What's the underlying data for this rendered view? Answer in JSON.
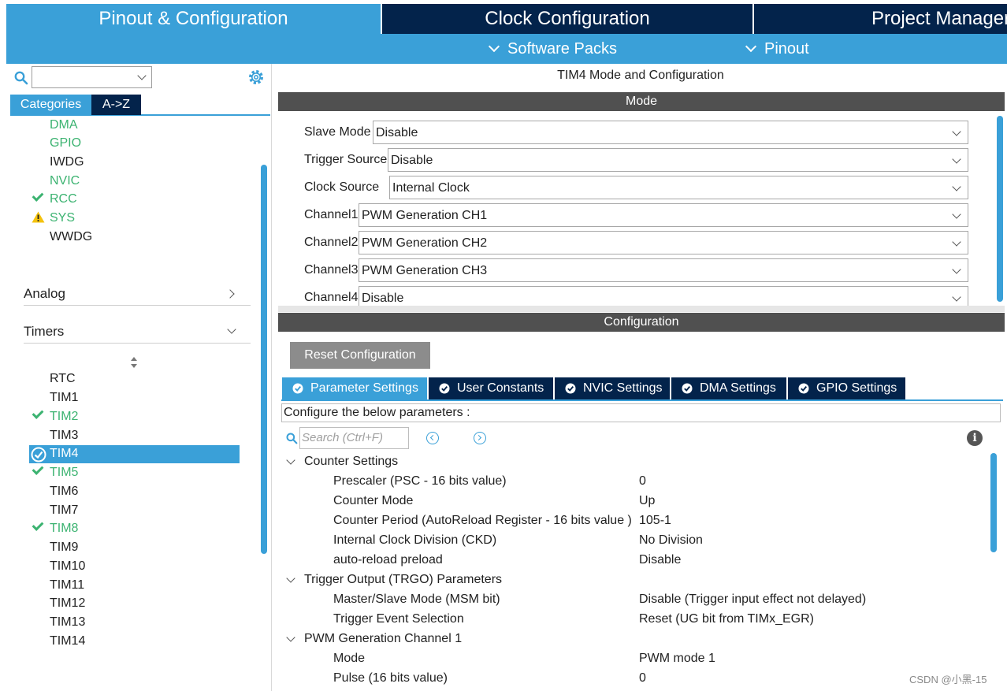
{
  "top_tabs": [
    "Pinout & Configuration",
    "Clock Configuration",
    "Project Manager"
  ],
  "sub_tabs": [
    "Software Packs",
    "Pinout"
  ],
  "left": {
    "category_tabs": [
      "Categories",
      "A->Z"
    ],
    "system_items": [
      {
        "label": "DMA",
        "state": "green"
      },
      {
        "label": "GPIO",
        "state": "green"
      },
      {
        "label": "IWDG",
        "state": "plain"
      },
      {
        "label": "NVIC",
        "state": "green"
      },
      {
        "label": "RCC",
        "state": "check"
      },
      {
        "label": "SYS",
        "state": "warning"
      },
      {
        "label": "WWDG",
        "state": "plain"
      }
    ],
    "sections": [
      "Analog",
      "Timers"
    ],
    "timer_items": [
      {
        "label": "RTC",
        "state": "plain"
      },
      {
        "label": "TIM1",
        "state": "plain"
      },
      {
        "label": "TIM2",
        "state": "check"
      },
      {
        "label": "TIM3",
        "state": "plain"
      },
      {
        "label": "TIM4",
        "state": "selected"
      },
      {
        "label": "TIM5",
        "state": "check"
      },
      {
        "label": "TIM6",
        "state": "plain"
      },
      {
        "label": "TIM7",
        "state": "plain"
      },
      {
        "label": "TIM8",
        "state": "check"
      },
      {
        "label": "TIM9",
        "state": "plain"
      },
      {
        "label": "TIM10",
        "state": "plain"
      },
      {
        "label": "TIM11",
        "state": "plain"
      },
      {
        "label": "TIM12",
        "state": "plain"
      },
      {
        "label": "TIM13",
        "state": "plain"
      },
      {
        "label": "TIM14",
        "state": "plain"
      }
    ]
  },
  "mode": {
    "title": "TIM4 Mode and Configuration",
    "header": "Mode",
    "rows": [
      {
        "label": "Slave Mode",
        "value": "Disable"
      },
      {
        "label": "Trigger Source",
        "value": "Disable"
      },
      {
        "label": "Clock Source",
        "value": "Internal Clock"
      },
      {
        "label": "Channel1",
        "value": "PWM Generation CH1"
      },
      {
        "label": "Channel2",
        "value": "PWM Generation CH2"
      },
      {
        "label": "Channel3",
        "value": "PWM Generation CH3"
      },
      {
        "label": "Channel4",
        "value": "Disable"
      }
    ]
  },
  "config": {
    "header": "Configuration",
    "reset_label": "Reset Configuration",
    "tabs": [
      "Parameter Settings",
      "User Constants",
      "NVIC Settings",
      "DMA Settings",
      "GPIO Settings"
    ],
    "description": "Configure the below parameters :",
    "search_placeholder": "Search (Ctrl+F)",
    "groups": [
      {
        "name": "Counter Settings",
        "params": [
          {
            "name": "Prescaler (PSC - 16 bits value)",
            "value": "0"
          },
          {
            "name": "Counter Mode",
            "value": "Up"
          },
          {
            "name": "Counter Period (AutoReload Register - 16 bits value )",
            "value": "105-1"
          },
          {
            "name": "Internal Clock Division (CKD)",
            "value": "No Division"
          },
          {
            "name": "auto-reload preload",
            "value": "Disable"
          }
        ]
      },
      {
        "name": "Trigger Output (TRGO) Parameters",
        "params": [
          {
            "name": "Master/Slave Mode (MSM bit)",
            "value": "Disable (Trigger input effect not delayed)"
          },
          {
            "name": "Trigger Event Selection",
            "value": "Reset (UG bit from TIMx_EGR)"
          }
        ]
      },
      {
        "name": "PWM Generation Channel 1",
        "params": [
          {
            "name": "Mode",
            "value": "PWM mode 1"
          },
          {
            "name": "Pulse (16 bits value)",
            "value": "0"
          }
        ]
      }
    ]
  },
  "watermark": "CSDN @小黑-15",
  "colors": {
    "accent": "#3aa0d8",
    "navy": "#03234b",
    "green": "#3cb371",
    "header_gray": "#505050"
  }
}
